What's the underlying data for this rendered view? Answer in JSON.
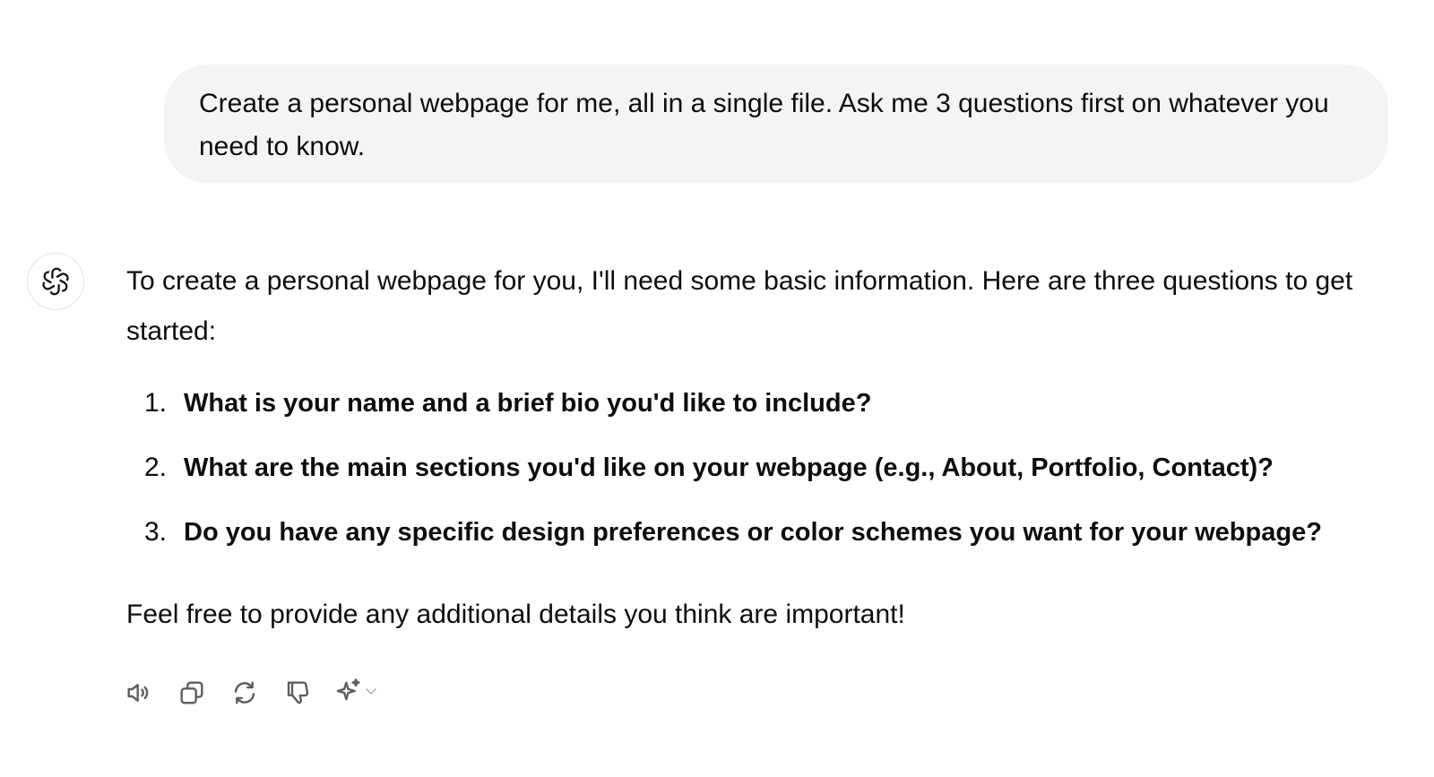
{
  "user_message": {
    "text": "Create a personal webpage for me, all in a single file. Ask me 3 questions first on whatever you need to know."
  },
  "assistant_message": {
    "intro": "To create a personal webpage for you, I'll need some basic information. Here are three questions to get started:",
    "questions": [
      {
        "number": "1.",
        "text": "What is your name and a brief bio you'd like to include?"
      },
      {
        "number": "2.",
        "text": "What are the main sections you'd like on your webpage (e.g., About, Portfolio, Contact)?"
      },
      {
        "number": "3.",
        "text": "Do you have any specific design preferences or color schemes you want for your webpage?"
      }
    ],
    "outro": "Feel free to provide any additional details you think are important!"
  },
  "actions": [
    {
      "icon": "speaker-icon"
    },
    {
      "icon": "copy-icon"
    },
    {
      "icon": "regenerate-icon"
    },
    {
      "icon": "thumbs-down-icon"
    },
    {
      "icon": "sparkle-icon"
    },
    {
      "icon": "chevron-down-icon"
    }
  ],
  "colors": {
    "bubble_bg": "#f4f4f4",
    "text": "#0d0d0d",
    "icon": "#5d5d5d"
  }
}
